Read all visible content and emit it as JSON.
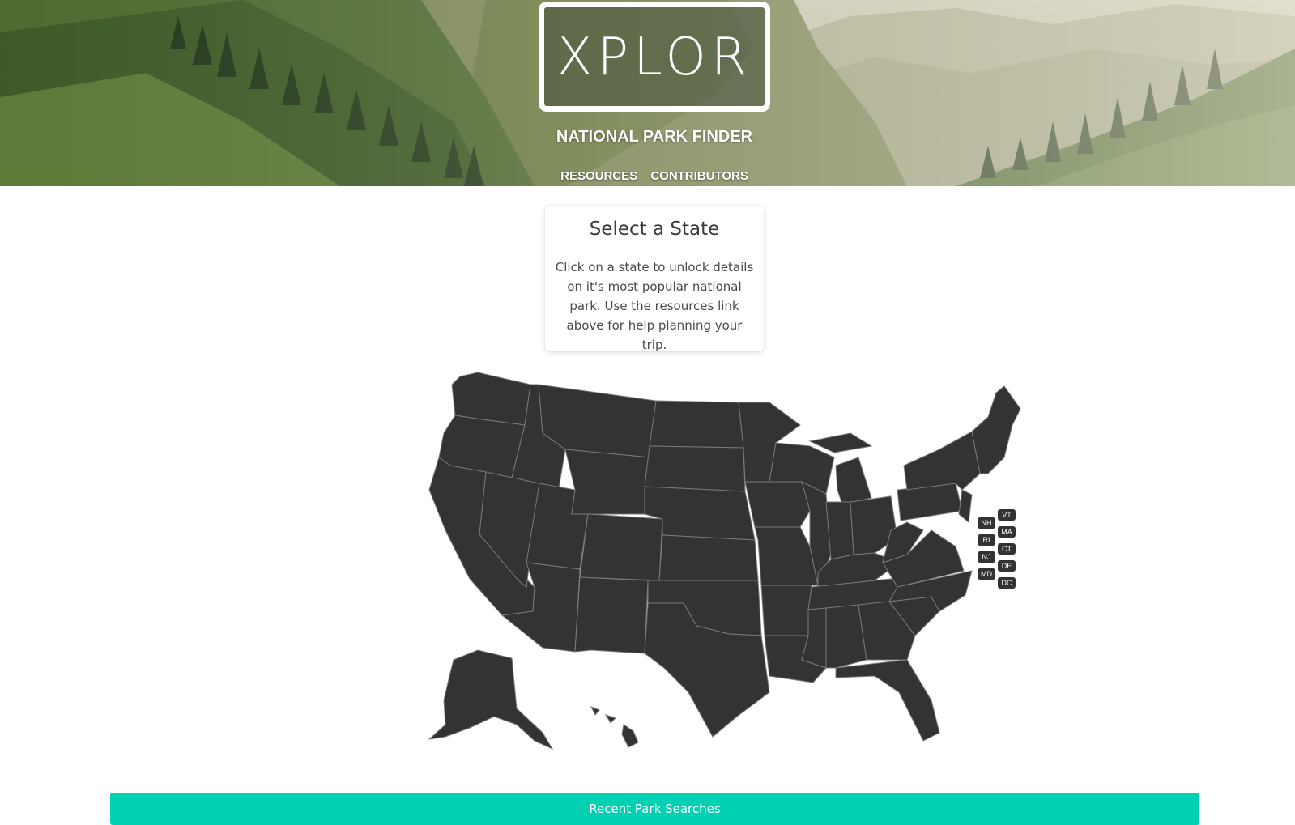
{
  "header": {
    "logo_text": "XPLOR",
    "subtitle": "NATIONAL PARK FINDER",
    "nav": [
      {
        "label": "RESOURCES"
      },
      {
        "label": "CONTRIBUTORS"
      }
    ]
  },
  "intro_card": {
    "title": "Select a State",
    "body": "Click on a state to unlock details on it's most popular national park. Use the resources link above for help planning your trip."
  },
  "map": {
    "small_state_labels": [
      "NH",
      "VT",
      "RI",
      "MA",
      "NJ",
      "CT",
      "MD",
      "DE",
      "DC"
    ],
    "fill_color": "#333333",
    "border_color": "#7a7a7a"
  },
  "footer": {
    "recent_searches_label": "Recent Park Searches",
    "button_color": "#00d1b2"
  }
}
